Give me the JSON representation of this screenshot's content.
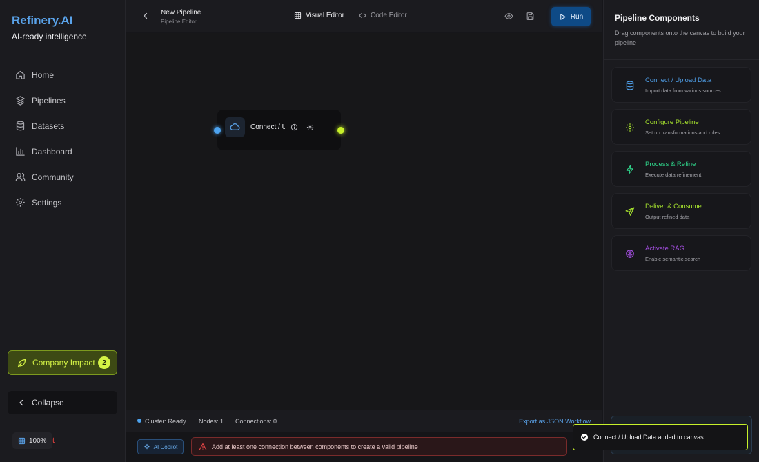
{
  "app": {
    "brand": "Refinery.AI",
    "tagline": "AI-ready intelligence"
  },
  "sidebar": {
    "items": [
      {
        "label": "Home",
        "icon": "home-icon"
      },
      {
        "label": "Pipelines",
        "icon": "layers-icon"
      },
      {
        "label": "Datasets",
        "icon": "database-icon"
      },
      {
        "label": "Dashboard",
        "icon": "bar-chart-icon"
      },
      {
        "label": "Community",
        "icon": "users-icon"
      },
      {
        "label": "Settings",
        "icon": "gear-icon"
      }
    ],
    "impact": {
      "label": "Company Impact",
      "badge": "2",
      "icon": "leaf-icon"
    },
    "collapse_label": "Collapse",
    "zoom": "100%",
    "zoom_overflow": "t"
  },
  "topbar": {
    "pipeline_name": "New Pipeline",
    "pipeline_sub": "Pipeline Editor",
    "tabs": [
      {
        "label": "Visual Editor",
        "icon": "grid-icon",
        "active": true
      },
      {
        "label": "Code Editor",
        "icon": "code-icon",
        "active": false
      }
    ],
    "run_label": "Run"
  },
  "canvas": {
    "node": {
      "label": "Connect / Upload Data",
      "icon": "cloud-icon"
    }
  },
  "statusbar": {
    "cluster": "Cluster: Ready",
    "nodes": "Nodes: 1",
    "connections": "Connections: 0",
    "export": "Export as JSON Workflow"
  },
  "bottombar": {
    "copilot": "AI Copilot",
    "warning": "Add at least one connection between components to create a valid pipeline"
  },
  "rpanel": {
    "title": "Pipeline Components",
    "subtitle": "Drag components onto the canvas to build your pipeline",
    "components": [
      {
        "title": "Connect / Upload Data",
        "desc": "Import data from various sources",
        "color": "#4f9fe8",
        "icon": "database-icon"
      },
      {
        "title": "Configure Pipeline",
        "desc": "Set up transformations and rules",
        "color": "#a6e22e",
        "icon": "gear-icon"
      },
      {
        "title": "Process & Refine",
        "desc": "Execute data refinement",
        "color": "#2fd48a",
        "icon": "lightning-icon"
      },
      {
        "title": "Deliver & Consume",
        "desc": "Output refined data",
        "color": "#a6e22e",
        "icon": "send-icon"
      },
      {
        "title": "Activate RAG",
        "desc": "Enable semantic search",
        "color": "#a34ee0",
        "icon": "brain-icon"
      }
    ]
  },
  "toast": {
    "message": "Connect / Upload Data added to canvas"
  },
  "colors": {
    "accent": "#5aa3ea",
    "lime": "#c7f02a",
    "danger": "#e64646"
  }
}
